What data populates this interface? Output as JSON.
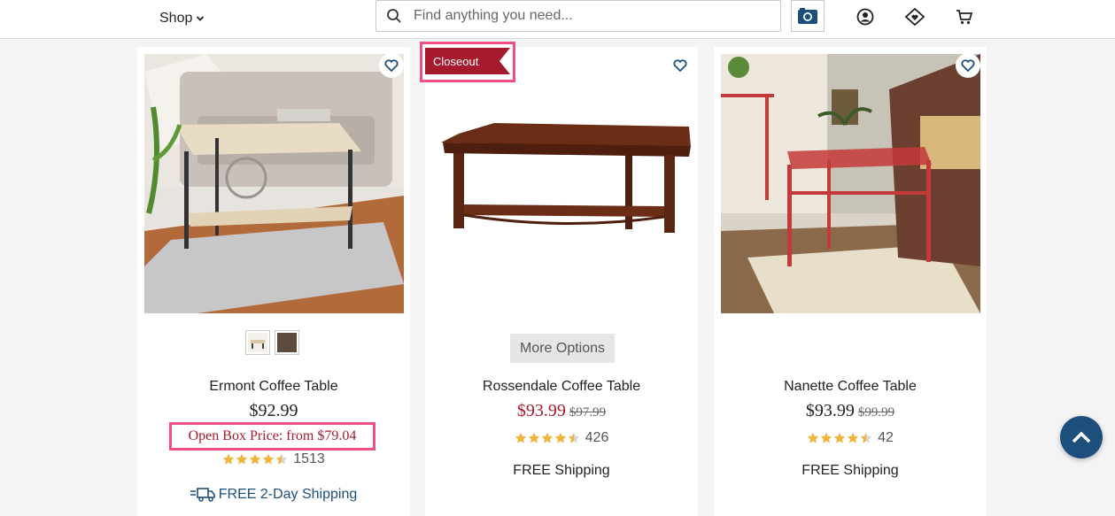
{
  "header": {
    "shop_label": "Shop",
    "search_placeholder": "Find anything you need...",
    "icons": [
      "search-icon",
      "camera-icon",
      "account-icon",
      "home-heart-icon",
      "cart-icon"
    ]
  },
  "products": [
    {
      "name": "Ermont Coffee Table",
      "price": "$92.99",
      "open_box": "Open Box Price: from $79.04",
      "rating": 4.5,
      "reviews": "1513",
      "shipping": "FREE 2-Day Shipping"
    },
    {
      "badge": "Closeout",
      "more_options": "More Options",
      "name": "Rossendale Coffee Table",
      "price": "$93.99",
      "was_price": "$97.99",
      "rating": 4.5,
      "reviews": "426",
      "shipping": "FREE Shipping"
    },
    {
      "name": "Nanette Coffee Table",
      "price": "$93.99",
      "was_price": "$99.99",
      "rating": 4.5,
      "reviews": "42",
      "shipping": "FREE Shipping"
    }
  ],
  "colors": {
    "accent_blue": "#1d4f7c",
    "sale_red": "#a51b2d",
    "highlight_pink": "#ee4f86",
    "star_gold": "#f0b53a"
  }
}
